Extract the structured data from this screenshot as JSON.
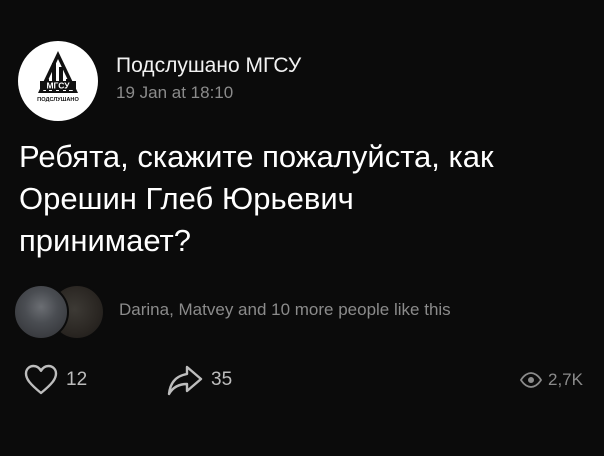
{
  "post": {
    "author": "Подслушано МГСУ",
    "timestamp": "19 Jan at 18:10",
    "avatar": {
      "top_text": "МГСУ",
      "bottom_text": "ПОДСЛУШАНО"
    },
    "text_lines": [
      "Ребята, скажите пожалуйста, как",
      "Орешин Глеб Юрьевич",
      "принимает?"
    ],
    "likers_text": "Darina, Matvey and 10 more people like this",
    "likes_count": "12",
    "shares_count": "35",
    "views_count": "2,7K"
  },
  "icons": {
    "like": "heart-icon",
    "share": "share-arrow-icon",
    "views": "eye-icon"
  },
  "colors": {
    "background": "#0b0b0b",
    "text_primary": "#ffffff",
    "text_secondary": "#8b8b8b"
  }
}
